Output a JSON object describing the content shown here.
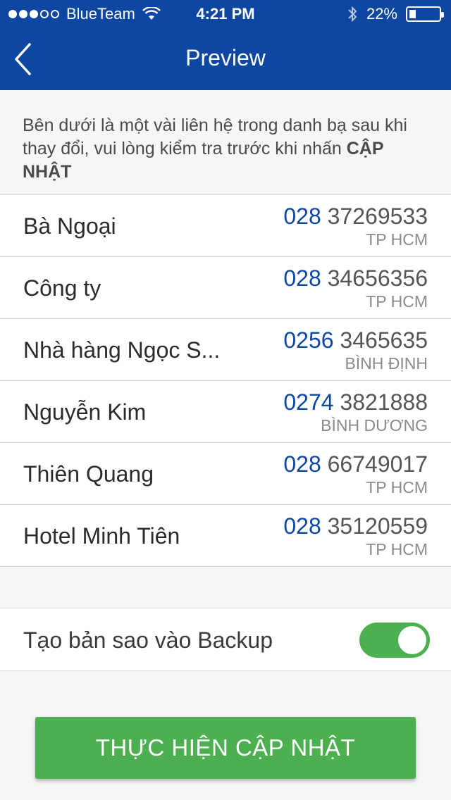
{
  "status_bar": {
    "carrier": "BlueTeam",
    "time": "4:21 PM",
    "battery": "22%",
    "battery_level": 0.22,
    "icons": [
      "signal-dots-icon",
      "wifi-icon",
      "bluetooth-icon",
      "battery-icon"
    ]
  },
  "nav": {
    "title": "Preview",
    "back_icon": "chevron-left-icon"
  },
  "intro": {
    "text": "Bên dưới là một vài liên hệ trong danh bạ sau khi thay đổi, vui lòng kiểm tra trước khi nhấn ",
    "emphasis": "CẬP NHẬT"
  },
  "contacts": [
    {
      "name": "Bà Ngoại",
      "code": "028",
      "number": " 37269533",
      "region": "TP HCM"
    },
    {
      "name": "Công ty",
      "code": "028",
      "number": " 34656356",
      "region": "TP HCM"
    },
    {
      "name": "Nhà hàng Ngọc S...",
      "code": "0256",
      "number": " 3465635",
      "region": "BÌNH ĐỊNH"
    },
    {
      "name": "Nguyễn Kim",
      "code": "0274",
      "number": " 3821888",
      "region": "BÌNH DƯƠNG"
    },
    {
      "name": "Thiên Quang",
      "code": "028",
      "number": " 66749017",
      "region": "TP HCM"
    },
    {
      "name": "Hotel Minh Tiên",
      "code": "028",
      "number": " 35120559",
      "region": "TP HCM"
    }
  ],
  "backup": {
    "label": "Tạo bản sao vào Backup",
    "enabled": true
  },
  "submit_label": "THỰC HIỆN CẬP NHẬT",
  "colors": {
    "nav_blue": "#0d47a1",
    "accent_green": "#4caf50"
  }
}
